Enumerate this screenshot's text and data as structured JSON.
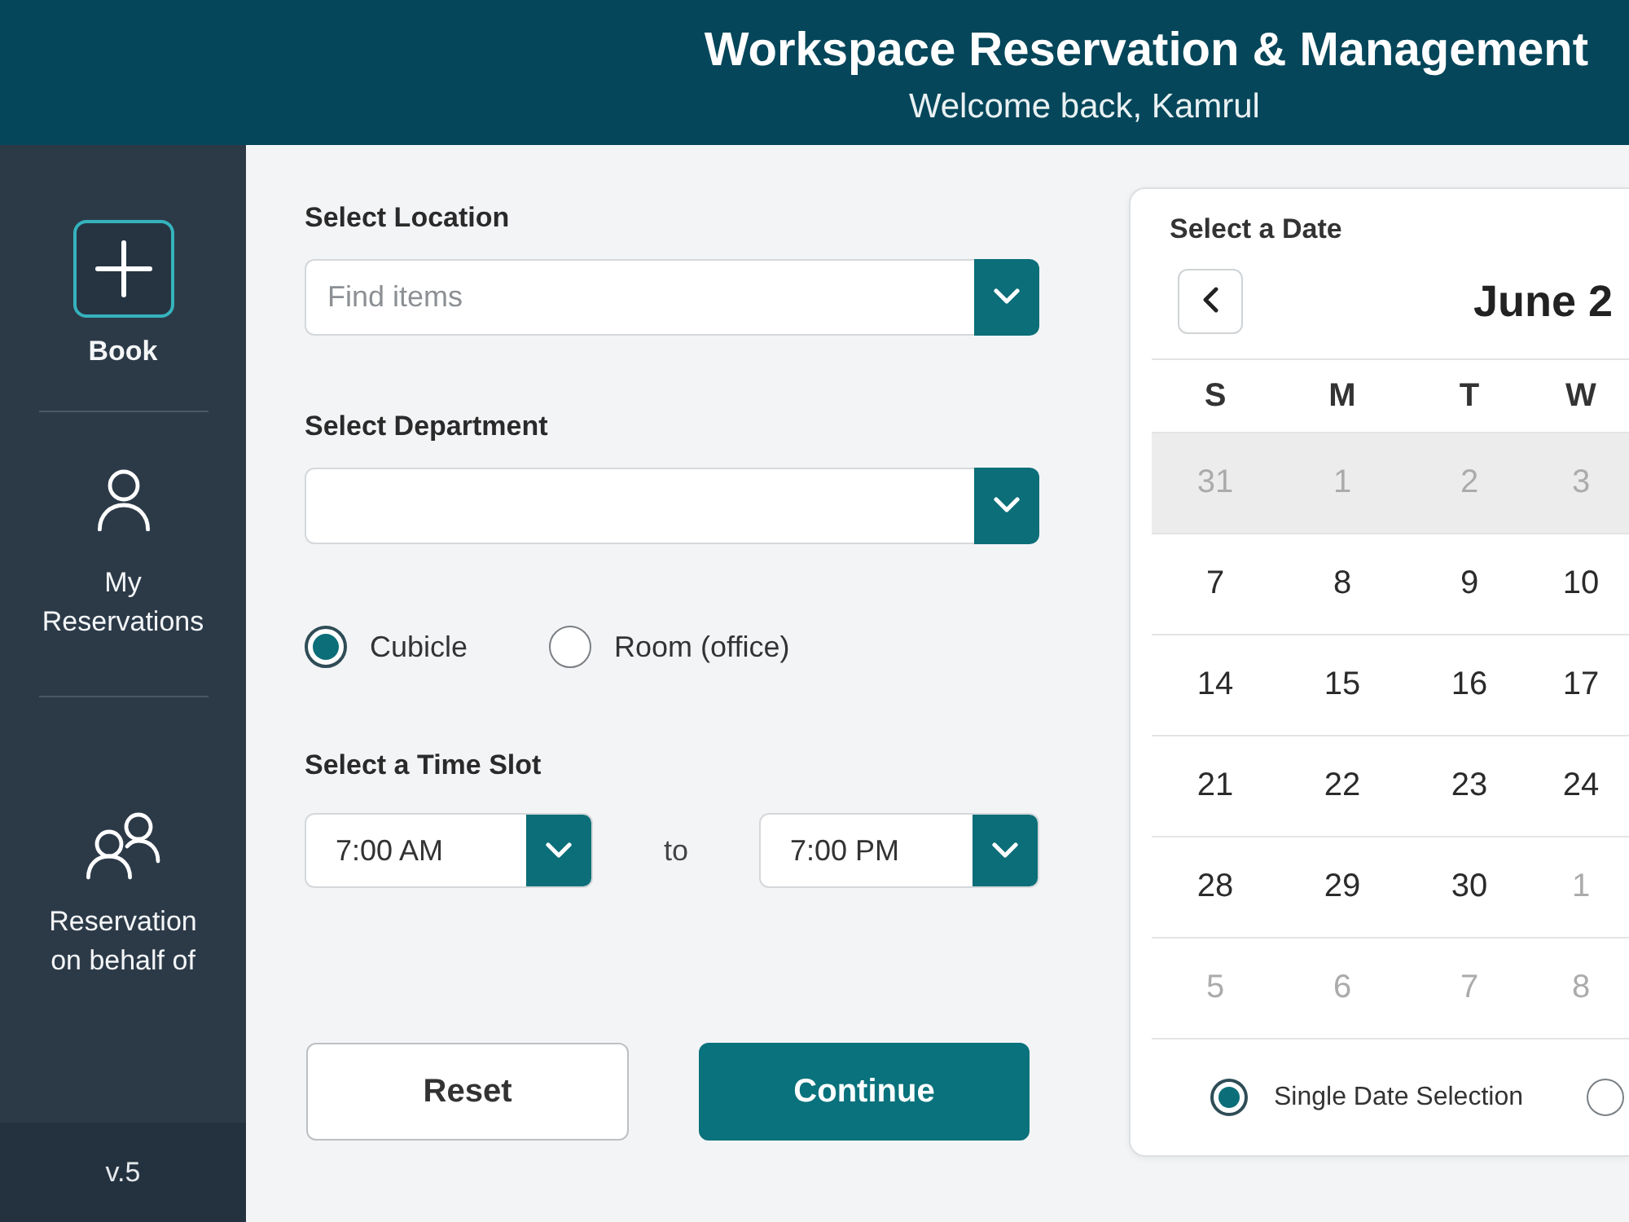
{
  "header": {
    "title": "Workspace Reservation & Management",
    "subtitle": "Welcome back, Kamrul"
  },
  "sidebar": {
    "items": [
      {
        "label": "Book",
        "selected": true
      },
      {
        "label": "My Reservations",
        "selected": false
      },
      {
        "label": "Reservation on behalf of",
        "selected": false
      }
    ],
    "version": "v.5"
  },
  "form": {
    "location": {
      "label": "Select Location",
      "placeholder": "Find items"
    },
    "department": {
      "label": "Select Department"
    },
    "space_type": [
      {
        "label": "Cubicle",
        "selected": true
      },
      {
        "label": "Room (office)",
        "selected": false
      }
    ],
    "time_slot": {
      "label": "Select a Time Slot",
      "from": "7:00 AM",
      "separator": "to",
      "to": "7:00 PM"
    },
    "buttons": [
      {
        "label": "Reset",
        "kind": "secondary"
      },
      {
        "label": "Continue",
        "kind": "primary"
      }
    ]
  },
  "calendar": {
    "title": "Select a Date",
    "month": "June 2",
    "weekdays": [
      "S",
      "M",
      "T",
      "W"
    ],
    "weeks": [
      {
        "highlighted": true,
        "days": [
          {
            "label": "31",
            "disabled": true
          },
          {
            "label": "1",
            "disabled": true
          },
          {
            "label": "2",
            "disabled": true
          },
          {
            "label": "3",
            "disabled": true
          }
        ]
      },
      {
        "highlighted": false,
        "days": [
          {
            "label": "7",
            "disabled": false
          },
          {
            "label": "8",
            "disabled": false
          },
          {
            "label": "9",
            "disabled": false
          },
          {
            "label": "10",
            "disabled": false
          }
        ]
      },
      {
        "highlighted": false,
        "days": [
          {
            "label": "14",
            "disabled": false
          },
          {
            "label": "15",
            "disabled": false
          },
          {
            "label": "16",
            "disabled": false
          },
          {
            "label": "17",
            "disabled": false
          }
        ]
      },
      {
        "highlighted": false,
        "days": [
          {
            "label": "21",
            "disabled": false
          },
          {
            "label": "22",
            "disabled": false
          },
          {
            "label": "23",
            "disabled": false
          },
          {
            "label": "24",
            "disabled": false
          }
        ]
      },
      {
        "highlighted": false,
        "days": [
          {
            "label": "28",
            "disabled": false
          },
          {
            "label": "29",
            "disabled": false
          },
          {
            "label": "30",
            "disabled": false
          },
          {
            "label": "1",
            "disabled": true
          }
        ]
      },
      {
        "highlighted": false,
        "days": [
          {
            "label": "5",
            "disabled": true
          },
          {
            "label": "6",
            "disabled": true
          },
          {
            "label": "7",
            "disabled": true
          },
          {
            "label": "8",
            "disabled": true
          }
        ]
      }
    ],
    "date_mode": [
      {
        "label": "Single Date Selection",
        "selected": true
      },
      {
        "selected": false
      }
    ]
  }
}
